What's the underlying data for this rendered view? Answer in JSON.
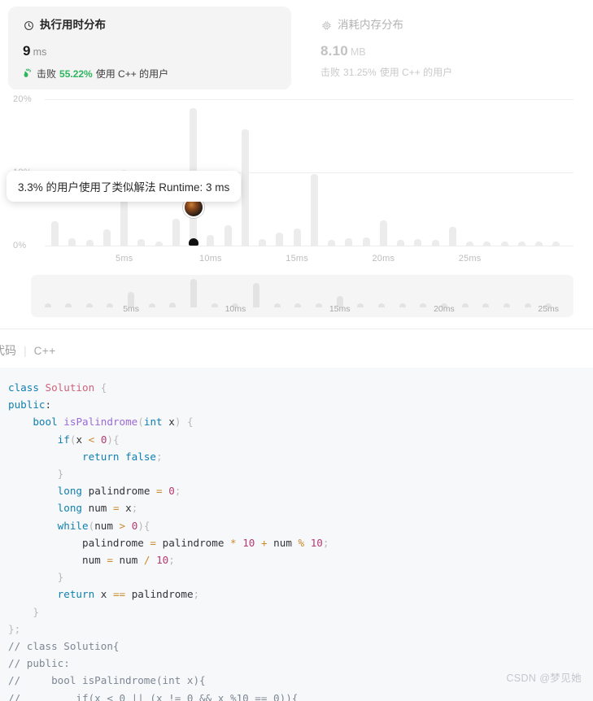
{
  "runtime_card": {
    "icon": "clock-icon",
    "title": "执行用时分布",
    "value": "9",
    "unit": "ms",
    "beat_icon": "clap-hands-icon",
    "beat_prefix": "击败",
    "beat_percent": "55.22%",
    "beat_suffix": "使用 C++ 的用户"
  },
  "memory_card": {
    "icon": "memory-chip-icon",
    "title": "消耗内存分布",
    "value": "8.10",
    "unit": "MB",
    "beat_prefix": "击败",
    "beat_percent": "31.25%",
    "beat_suffix": "使用 C++ 的用户"
  },
  "tooltip": {
    "text": "3.3% 的用户使用了类似解法 Runtime: 3 ms"
  },
  "code_header": {
    "label": "代码",
    "separator": "|",
    "language": "C++"
  },
  "code": "class Solution {\npublic:\n    bool isPalindrome(int x) {\n        if(x < 0){\n            return false;\n        }\n        long palindrome = 0;\n        long num = x;\n        while(num > 0){\n            palindrome = palindrome * 10 + num % 10;\n            num = num / 10;\n        }\n        return x == palindrome;\n    }\n};\n// class Solution{\n// public:\n//     bool isPalindrome(int x){\n//         if(x < 0 || (x != 0 && x %10 == 0)){",
  "watermark": "CSDN @梦见她",
  "chart_data": {
    "type": "bar",
    "title": "执行用时分布",
    "xlabel": "",
    "ylabel": "",
    "ylim": [
      0,
      20
    ],
    "yticks": [
      "0%",
      "10%",
      "20%"
    ],
    "ytick_values": [
      0,
      10,
      20
    ],
    "xticks": [
      "5ms",
      "10ms",
      "15ms",
      "20ms",
      "25ms"
    ],
    "xtick_values": [
      5,
      10,
      15,
      20,
      25
    ],
    "grid": true,
    "legend": null,
    "highlight": {
      "x": 9,
      "label": "Runtime: 3 ms",
      "percent": "3.3%",
      "note": "3.3% 的用户使用了类似解法 Runtime: 3 ms"
    },
    "x": [
      1,
      2,
      3,
      4,
      5,
      6,
      7,
      8,
      9,
      10,
      11,
      12,
      13,
      14,
      15,
      16,
      17,
      18,
      19,
      20,
      21,
      22,
      23,
      24,
      25,
      26,
      27,
      28,
      29,
      30
    ],
    "categories": [
      "1ms",
      "2ms",
      "3ms",
      "4ms",
      "5ms",
      "6ms",
      "7ms",
      "8ms",
      "9ms",
      "10ms",
      "11ms",
      "12ms",
      "13ms",
      "14ms",
      "15ms",
      "16ms",
      "17ms",
      "18ms",
      "19ms",
      "20ms",
      "21ms",
      "22ms",
      "23ms",
      "24ms",
      "25ms",
      "26ms",
      "27ms",
      "28ms",
      "29ms",
      "30ms"
    ],
    "values": [
      3.3,
      1.0,
      0.8,
      2.2,
      10.3,
      0.9,
      0.6,
      3.7,
      18.8,
      1.5,
      2.8,
      15.9,
      0.9,
      1.8,
      2.3,
      9.8,
      0.8,
      1.0,
      1.1,
      3.4,
      0.8,
      0.9,
      0.8,
      2.6,
      0.6,
      0.5,
      0.5,
      0.4,
      0.4,
      0.3
    ]
  },
  "brush_chart": {
    "type": "bar",
    "xticks": [
      "5ms",
      "10ms",
      "15ms",
      "20ms",
      "25ms"
    ],
    "values": [
      1.0,
      0.8,
      0.8,
      0.9,
      5.2,
      0.7,
      1.6,
      9.8,
      0.8,
      1.1,
      8.4,
      0.8,
      0.9,
      1.0,
      4.0,
      0.8,
      0.8,
      0.9,
      1.0,
      0.8,
      0.8,
      0.8,
      0.8,
      0.8,
      0.7
    ]
  }
}
